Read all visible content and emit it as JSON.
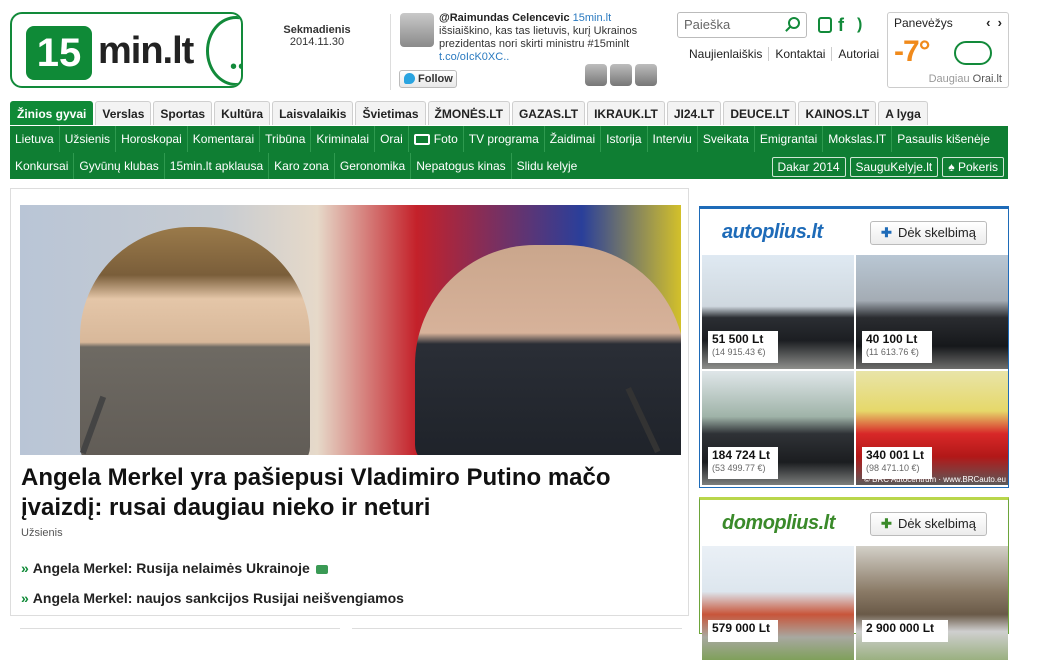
{
  "logo": {
    "number": "15",
    "text": "min.lt"
  },
  "date": {
    "weekday": "Sekmadienis",
    "value": "2014.11.30"
  },
  "tweet": {
    "user": "@Raimundas Celencevic",
    "via": "15min.lt",
    "text": "išsiaiškino, kas tas lietuvis, kurį Ukrainos prezidentas nori skirti ministru #15minlt",
    "link": "t.co/oIcK0XC..",
    "follow_label": "Follow"
  },
  "search": {
    "placeholder": "Paieška"
  },
  "top_links": [
    "Naujienlaiškis",
    "Kontaktai",
    "Autoriai"
  ],
  "weather": {
    "city": "Panevėžys",
    "prev": "‹",
    "next": "›",
    "temp": "-7°",
    "source_prefix": "Daugiau",
    "source": "Orai.lt",
    "icon": "cloud-icon"
  },
  "tabs": [
    "Žinios gyvai",
    "Verslas",
    "Sportas",
    "Kultūra",
    "Laisvalaikis",
    "Švietimas",
    "ŽMONĖS.LT",
    "GAZAS.LT",
    "IKRAUK.LT",
    "JI24.LT",
    "DEUCE.LT",
    "KAINOS.LT",
    "A lyga"
  ],
  "nav_row1": [
    "Lietuva",
    "Užsienis",
    "Horoskopai",
    "Komentarai",
    "Tribūna",
    "Kriminalai",
    "Orai",
    "Foto",
    "TV programa",
    "Žaidimai",
    "Istorija",
    "Interviu",
    "Sveikata",
    "Emigrantai",
    "Mokslas.IT",
    "Pasaulis kišenėje"
  ],
  "nav_row2": [
    "Konkursai",
    "Gyvūnų klubas",
    "15min.lt apklausa",
    "Karo zona",
    "Geronomika",
    "Nepatogus kinas",
    "Slidu kelyje"
  ],
  "nav_row2_right": [
    "Dakar 2014",
    "SauguKelyje.lt",
    "Pokeris"
  ],
  "article": {
    "headline": "Angela Merkel yra pašiepusi Vladimiro Putino mačo įvaizdį: rusai daugiau nieko ir neturi",
    "section": "Užsienis",
    "related": [
      "Angela Merkel: Rusija nelaimės Ukrainoje",
      "Angela Merkel: naujos sankcijos Rusijai neišvengiamos"
    ]
  },
  "ad_autoplius": {
    "logo": "autoplius.lt",
    "button": "Dėk skelbimą",
    "items": [
      {
        "price": "51 500 Lt",
        "eur": "(14 915.43 €)"
      },
      {
        "price": "40 100 Lt",
        "eur": "(11 613.76 €)"
      },
      {
        "price": "184 724 Lt",
        "eur": "(53 499.77 €)"
      },
      {
        "price": "340 001 Lt",
        "eur": "(98 471.10 €)"
      }
    ],
    "credit": "© BRC Autocentrum · www.BRCauto.eu"
  },
  "ad_domoplius": {
    "logo": "domoplius.lt",
    "button": "Dėk skelbimą",
    "items": [
      {
        "price": "579 000 Lt"
      },
      {
        "price": "2 900 000 Lt"
      }
    ]
  }
}
